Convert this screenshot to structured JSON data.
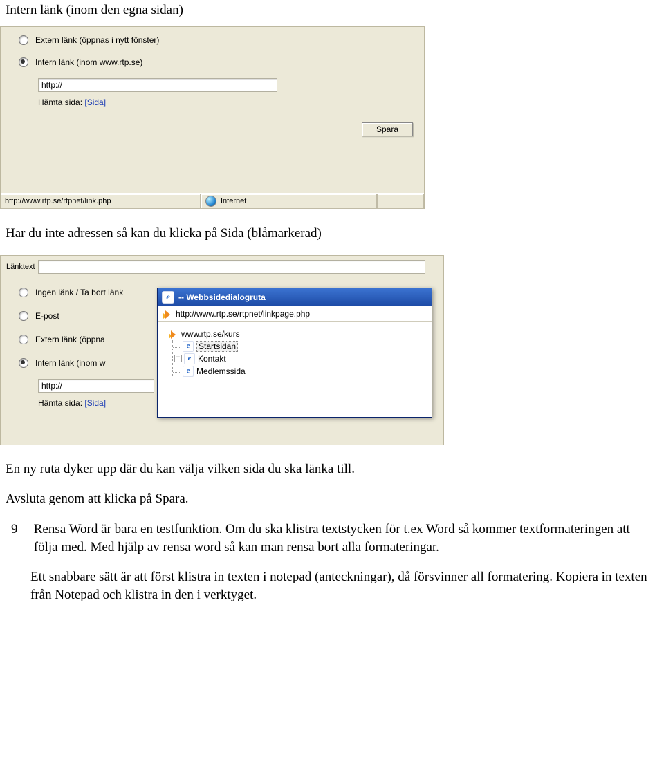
{
  "doc": {
    "heading": "Intern länk (inom den egna sidan)",
    "para1": "Har du inte adressen så kan du klicka på Sida (blåmarkerad)",
    "para2": "En ny ruta dyker upp där du kan välja vilken sida du ska länka till.",
    "para3": "Avsluta genom att klicka på Spara.",
    "item9_num": "9",
    "item9_body": "Rensa Word är bara en testfunktion. Om du ska klistra textstycken för t.ex Word så kommer textformateringen att följa med. Med hjälp av rensa word så kan man rensa bort alla formateringar.",
    "item9_para2": "Ett snabbare sätt är att först klistra in texten i notepad (anteckningar), då försvinner all formatering. Kopiera in texten från Notepad och klistra in den i verktyget."
  },
  "ss1": {
    "radio_extern": "Extern länk (öppnas i nytt fönster)",
    "radio_intern": "Intern länk (inom www.rtp.se)",
    "url_value": "http://",
    "hamta_label": "Hämta sida:",
    "sida_link": "[Sida]",
    "spara_btn": "Spara",
    "status_url": "http://www.rtp.se/rtpnet/link.php",
    "status_zone": "Internet"
  },
  "ss2": {
    "lanktext_label": "Länktext",
    "radio_ingen": "Ingen länk / Ta bort länk",
    "radio_epost": "E-post",
    "radio_extern": "Extern länk (öppna",
    "radio_intern": "Intern länk (inom w",
    "url_value": "http://",
    "hamta_label": "Hämta sida:",
    "sida_link": "[Sida]",
    "dialog": {
      "title": "-- Webbsidedialogruta",
      "addr": "http://www.rtp.se/rtpnet/linkpage.php",
      "root": "www.rtp.se/kurs",
      "items": [
        "Startsidan",
        "Kontakt",
        "Medlemssida"
      ],
      "selected_index": 0,
      "expander_index": 1
    }
  }
}
